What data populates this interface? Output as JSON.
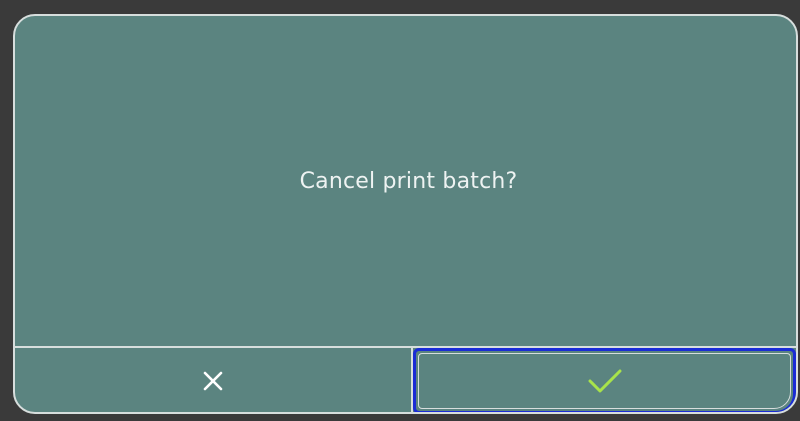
{
  "dialog": {
    "message": "Cancel print batch?"
  },
  "buttons": {
    "cancel_icon": "close-icon",
    "confirm_icon": "checkmark-icon"
  },
  "colors": {
    "panel": "#5b8480",
    "border": "#d7dedd",
    "text": "#eef3f2",
    "cancel_glyph": "#ffffff",
    "confirm_glyph": "#a8e34a",
    "focus_ring": "#1a2bd6"
  }
}
